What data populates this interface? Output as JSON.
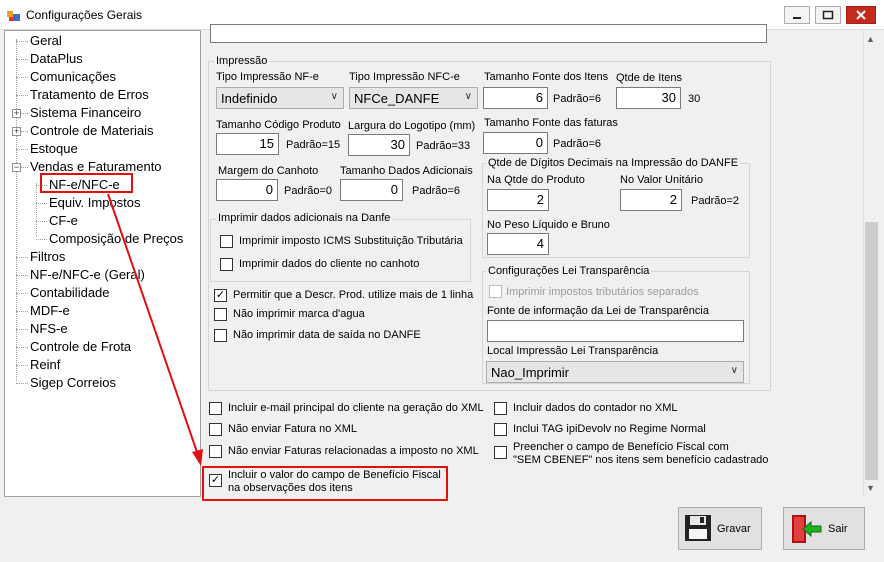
{
  "window": {
    "title": "Configurações Gerais"
  },
  "icons": {
    "app": "app-icon",
    "minimize": "minimize-icon",
    "maximize": "maximize-icon",
    "close": "close-icon",
    "save": "floppy-disk-icon",
    "exit": "exit-door-icon"
  },
  "colors": {
    "highlight": "#e01010",
    "close_button": "#c42b1c"
  },
  "tree": {
    "items": [
      {
        "label": "Geral"
      },
      {
        "label": "DataPlus"
      },
      {
        "label": "Comunicações"
      },
      {
        "label": "Tratamento de Erros"
      },
      {
        "label": "Sistema Financeiro",
        "expander": "+"
      },
      {
        "label": "Controle de Materiais",
        "expander": "+"
      },
      {
        "label": "Estoque"
      },
      {
        "label": "Vendas e Faturamento",
        "expander": "−"
      },
      {
        "label": "NF-e/NFC-e",
        "selected": true
      },
      {
        "label": "Equiv. Impostos"
      },
      {
        "label": "CF-e"
      },
      {
        "label": "Composição de Preços"
      },
      {
        "label": "Filtros"
      },
      {
        "label": "NF-e/NFC-e (Geral)"
      },
      {
        "label": "Contabilidade"
      },
      {
        "label": "MDF-e"
      },
      {
        "label": "NFS-e"
      },
      {
        "label": "Controle de Frota"
      },
      {
        "label": "Reinf"
      },
      {
        "label": "Sigep Correios"
      }
    ]
  },
  "impressao": {
    "group_title": "Impressão",
    "tipo_nfe": {
      "label": "Tipo Impressão NF-e",
      "value": "Indefinido"
    },
    "tipo_nfce": {
      "label": "Tipo Impressão NFC-e",
      "value": "NFCe_DANFE"
    },
    "fonte_itens": {
      "label": "Tamanho Fonte dos Itens",
      "value": "6",
      "padrao": "Padrão=6"
    },
    "qtde_itens": {
      "label": "Qtde de Itens",
      "value": "30",
      "extra": "30"
    },
    "codigo_produto": {
      "label": "Tamanho Código Produto",
      "value": "15",
      "padrao": "Padrão=15"
    },
    "logotipo": {
      "label": "Largura do Logotipo (mm)",
      "value": "30",
      "padrao": "Padrão=33"
    },
    "fonte_faturas": {
      "label": "Tamanho Fonte das faturas",
      "value": "0",
      "padrao": "Padrão=6"
    },
    "margem_canhoto": {
      "label": "Margem do Canhoto",
      "value": "0",
      "padrao": "Padrão=0"
    },
    "dados_adicionais": {
      "label": "Tamanho Dados Adicionais",
      "value": "0",
      "padrao": "Padrão=6"
    },
    "decimais": {
      "group_title": "Qtde de Dígitos Decimais na Impressão do DANFE",
      "qtde_produto": {
        "label": "Na Qtde do Produto",
        "value": "2"
      },
      "valor_unitario": {
        "label": "No Valor Unitário",
        "value": "2",
        "padrao": "Padrão=2"
      },
      "peso": {
        "label": "No Peso Líquido e Bruno",
        "value": "4"
      }
    },
    "adicionais_danfe": {
      "group_title": "Imprimir dados adicionais na Danfe",
      "icms_st": {
        "label": "Imprimir imposto ICMS Substituição Tributária",
        "checked": false
      },
      "cliente_canhoto": {
        "label": "Imprimir dados do cliente no canhoto",
        "checked": false
      }
    },
    "descr_mais_linha": {
      "label": "Permitir que a Descr. Prod. utilize mais de 1 linha",
      "checked": true
    },
    "marca_agua": {
      "label": "Não imprimir marca d'agua",
      "checked": false
    },
    "data_saida": {
      "label": "Não imprimir data de saída no DANFE",
      "checked": false
    },
    "transparencia": {
      "group_title": "Configurações Lei Transparência",
      "tributos_separados": {
        "label": "Imprimir impostos tributários separados",
        "checked": false
      },
      "fonte_label": "Fonte de informação da Lei de Transparência",
      "fonte_value": "",
      "local_label": "Local Impressão Lei Transparência",
      "local_value": "Nao_Imprimir"
    }
  },
  "options": {
    "email_cliente": {
      "label": "Incluir e-mail principal do cliente na geração do XML",
      "checked": false
    },
    "nao_fatura": {
      "label": "Não enviar Fatura no XML",
      "checked": false
    },
    "faturas_relacionadas": {
      "label": "Não enviar Faturas relacionadas a imposto no XML",
      "checked": false
    },
    "beneficio_obs_line1": "Incluir o valor do campo de Benefício Fiscal",
    "beneficio_obs_line2": "na observações dos itens",
    "beneficio_obs_checked": true,
    "dados_contador": {
      "label": "Incluir dados do contador no XML",
      "checked": false
    },
    "tag_ipidevol": {
      "label": "Inclui TAG ipiDevolv no Regime Normal",
      "checked": false
    },
    "sem_cbenef_line1": "Preencher o campo de Benefício Fiscal com",
    "sem_cbenef_line2": "\"SEM CBENEF\" nos itens sem benefício cadastrado",
    "sem_cbenef_checked": false
  },
  "buttons": {
    "save": "Gravar",
    "exit": "Sair"
  }
}
